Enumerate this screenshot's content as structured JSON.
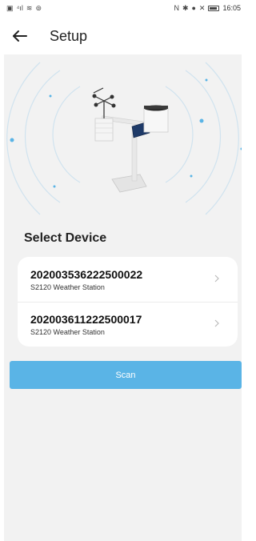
{
  "status_bar": {
    "time": "16:05",
    "left_icons": [
      "message-icon",
      "signal-icon",
      "wifi-icon",
      "location-icon"
    ],
    "right_icons": [
      "nfc-icon",
      "bluetooth-icon",
      "location-pin-icon",
      "mute-icon",
      "battery-icon"
    ]
  },
  "header": {
    "title": "Setup"
  },
  "main": {
    "section_title": "Select Device",
    "devices": [
      {
        "id": "202003536222500022",
        "model": "S2120 Weather Station"
      },
      {
        "id": "202003611222500017",
        "model": "S2120 Weather Station"
      }
    ],
    "scan_label": "Scan"
  },
  "colors": {
    "accent": "#5ab4e6",
    "background": "#f2f2f2",
    "card": "#ffffff"
  }
}
